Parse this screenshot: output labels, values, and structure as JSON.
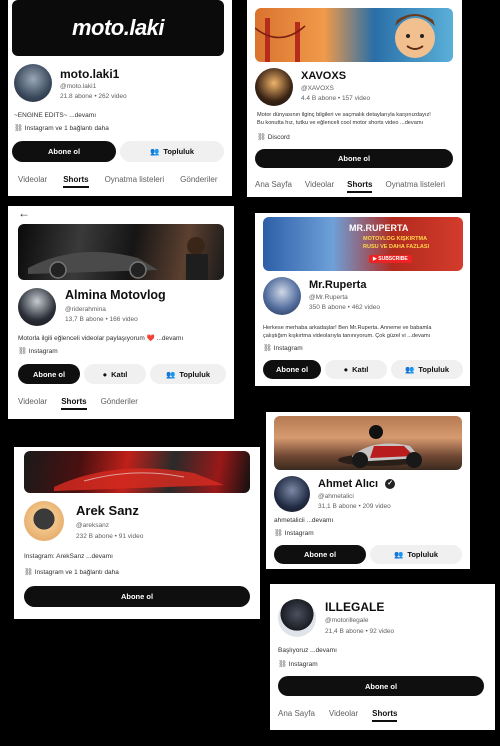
{
  "c1": {
    "banner_logo": "moto.laki",
    "name": "moto.laki1",
    "handle": "@moto.laki1",
    "stats": "21.8 abone • 262 video",
    "desc": "~ENGINE EDITS~ ...devamı",
    "links": "Instagram ve 1 bağlantı daha",
    "subscribe": "Abone ol",
    "community": "Topluluk",
    "tabs": [
      "Videolar",
      "Shorts",
      "Oynatma listeleri",
      "Gönderiler"
    ]
  },
  "c2": {
    "name": "XAVOXS",
    "handle": "@XAVOXS",
    "stats": "4.4 B abone • 157 video",
    "desc_line1": "Motor dünyasının ilginç bilgileri ve saçmalık detaylarıyla karşınızdayız!",
    "desc_line2": "Bu konutta hız, tutku ve eğlenceli cool motor shorts video ...devamı",
    "links": "Discord",
    "subscribe": "Abone ol",
    "tabs": [
      "Ana Sayfa",
      "Videolar",
      "Shorts",
      "Oynatma listeleri"
    ]
  },
  "c3": {
    "back": "←",
    "name": "Almina Motovlog",
    "handle": "@riderahmina",
    "stats": "13,7 B abone • 166 video",
    "desc": "Motorla ilgili eğlenceli videolar paylaşıyorum ❤️ ...devamı",
    "links": "Instagram",
    "subscribe": "Abone ol",
    "join": "Katıl",
    "community": "Topluluk",
    "tabs": [
      "Videolar",
      "Shorts",
      "Gönderiler"
    ]
  },
  "c4": {
    "banner_title": "MR.RUPERTA",
    "banner_sub1": "MOTOVLOG KIŞKIRTMA",
    "banner_sub2": "RUSU VE DAHA FAZLASI",
    "banner_sub_btn": "SUBSCRIBE",
    "name": "Mr.Ruperta",
    "handle": "@Mr.Ruperta",
    "stats": "350 B abone • 462 video",
    "desc_line1": "Herkese merhaba arkadaşlar! Ben Mr.Ruperta. Anneme ve babamla",
    "desc_line2": "çalıştığım kışkırtma videolarıyla tanınıyorum. Çok güzel vi ...devamı",
    "links": "Instagram",
    "subscribe": "Abone ol",
    "join": "Katıl",
    "community": "Topluluk"
  },
  "c5": {
    "name": "Ahmet Alıcı",
    "handle": "@ahmetalici",
    "stats": "31,1 B abone • 209 video",
    "desc": "ahmetalicii ...devamı",
    "links": "Instagram",
    "subscribe": "Abone ol",
    "community": "Topluluk"
  },
  "c6": {
    "name": "Arek Sanz",
    "handle": "@areksanz",
    "stats": "232 B abone • 91 video",
    "desc": "Instagram: ArekSanz ...devamı",
    "links": "Instagram ve 1 bağlantı daha",
    "subscribe": "Abone ol"
  },
  "c7": {
    "name": "ILLEGALE",
    "handle": "@motorillegale",
    "stats": "21,4 B abone • 92 video",
    "desc": "Başlıyoruz ...devamı",
    "links": "Instagram",
    "subscribe": "Abone ol",
    "tabs": [
      "Ana Sayfa",
      "Videolar",
      "Shorts"
    ]
  }
}
